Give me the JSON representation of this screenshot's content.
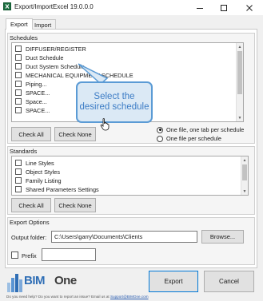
{
  "window": {
    "title": "Export/ImportExcel 19.0.0.0"
  },
  "tabs": [
    {
      "label": "Export",
      "active": true
    },
    {
      "label": "Import",
      "active": false
    }
  ],
  "schedules": {
    "label": "Schedules",
    "items": [
      {
        "label": "DIFFUSER/REGISTER",
        "checked": false
      },
      {
        "label": "Duct Schedule",
        "checked": false
      },
      {
        "label": "Duct System Schedule",
        "checked": false
      },
      {
        "label": "MECHANICAL EQUIPMENT SCHEDULE",
        "checked": false
      },
      {
        "label": "Piping...",
        "checked": false
      },
      {
        "label": "SPACE...",
        "checked": false
      },
      {
        "label": "Space...",
        "checked": false
      },
      {
        "label": "SPACE...",
        "checked": false
      }
    ],
    "check_all": "Check All",
    "check_none": "Check None",
    "radio_options": [
      {
        "label": "One file, one tab per schedule",
        "selected": true
      },
      {
        "label": "One file per schedule",
        "selected": false
      }
    ]
  },
  "standards": {
    "label": "Standards",
    "items": [
      {
        "label": "Line Styles",
        "checked": false
      },
      {
        "label": "Object Styles",
        "checked": false
      },
      {
        "label": "Family Listing",
        "checked": false
      },
      {
        "label": "Shared Parameters Settings",
        "checked": false
      }
    ],
    "check_all": "Check All",
    "check_none": "Check None"
  },
  "export_options": {
    "label": "Export Options",
    "output_folder_label": "Output folder:",
    "output_folder_value": "C:\\Users\\garry\\Documents\\Clients",
    "browse_label": "Browse...",
    "prefix_label": "Prefix",
    "prefix_value": ""
  },
  "actions": {
    "export_label": "Export",
    "cancel_label": "Cancel"
  },
  "callout": {
    "text": "Select the desired schedule"
  },
  "footer": {
    "logo_bim": "BIM",
    "logo_one": "One",
    "help_text": "Do you need help? Do you want to report an issue? Email us at",
    "help_link": "Support@BIMOne.com"
  },
  "colors": {
    "accent": "#0078d7",
    "callout_fill": "#dbe9f5",
    "callout_border": "#5b9bd5",
    "callout_text": "#3c7cc5",
    "logo_blue": "#2f6eb5"
  },
  "icons": {
    "app": "excel-app-icon",
    "cursor": "hand-pointer-icon"
  }
}
